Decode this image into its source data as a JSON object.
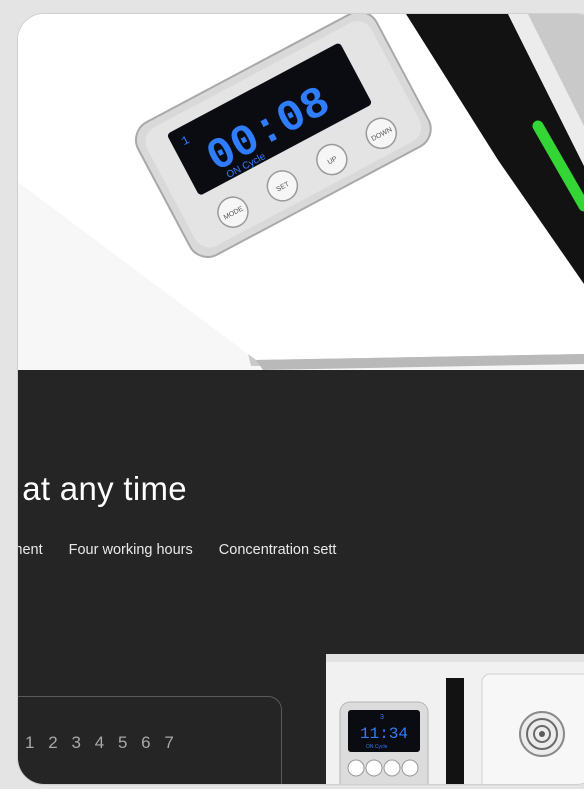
{
  "timer": {
    "display": "00:08",
    "channel": "1",
    "mode_text": "ON Cycle",
    "buttons": [
      "MODE",
      "SET",
      "UP",
      "DOWN"
    ]
  },
  "headline": "ray at any time",
  "features": [
    "gent time adjustment",
    "Four working hours",
    "Concentration sett"
  ],
  "panel_numbers": [
    "1",
    "2",
    "3",
    "4",
    "5",
    "6",
    "7"
  ],
  "small_display": {
    "channel": "3",
    "time": "11:34",
    "mode_text": "ON Cycle"
  },
  "colors": {
    "dark_bg": "#252525",
    "display_blue": "#2f7dff",
    "indicator_green": "#34d635"
  }
}
